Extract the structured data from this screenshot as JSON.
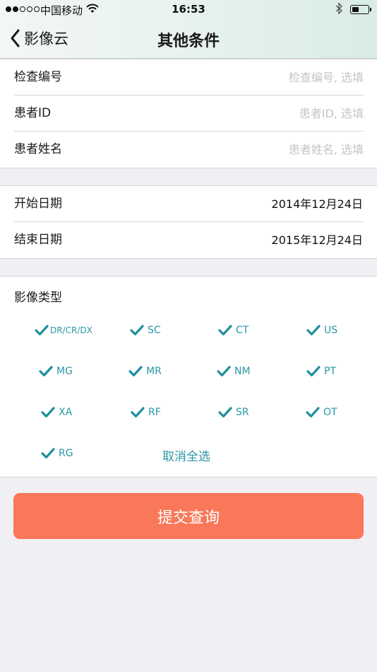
{
  "status_bar": {
    "carrier": "中国移动",
    "time": "16:53"
  },
  "nav": {
    "back_label": "影像云",
    "title": "其他条件"
  },
  "fields": [
    {
      "label": "检查编号",
      "placeholder": "检查编号, 选填"
    },
    {
      "label": "患者ID",
      "placeholder": "患者ID, 选填"
    },
    {
      "label": "患者姓名",
      "placeholder": "患者姓名, 选填"
    }
  ],
  "dates": [
    {
      "label": "开始日期",
      "value": "2014年12月24日"
    },
    {
      "label": "结束日期",
      "value": "2015年12月24日"
    }
  ],
  "image_types": {
    "title": "影像类型",
    "options": [
      {
        "label": "DR/CR/DX",
        "checked": true
      },
      {
        "label": "SC",
        "checked": true
      },
      {
        "label": "CT",
        "checked": true
      },
      {
        "label": "US",
        "checked": true
      },
      {
        "label": "MG",
        "checked": true
      },
      {
        "label": "MR",
        "checked": true
      },
      {
        "label": "NM",
        "checked": true
      },
      {
        "label": "PT",
        "checked": true
      },
      {
        "label": "XA",
        "checked": true
      },
      {
        "label": "RF",
        "checked": true
      },
      {
        "label": "SR",
        "checked": true
      },
      {
        "label": "OT",
        "checked": true
      },
      {
        "label": "RG",
        "checked": true
      }
    ],
    "deselect_all": "取消全选"
  },
  "submit_label": "提交查询",
  "colors": {
    "accent": "#2a97a5",
    "submit": "#f97859",
    "background": "#efeff4"
  }
}
